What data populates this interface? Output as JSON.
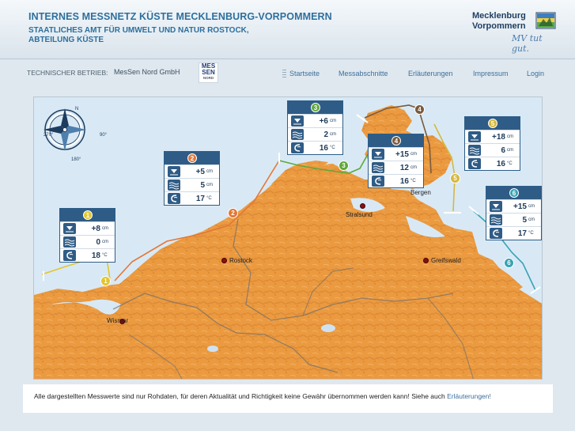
{
  "header": {
    "title": "INTERNES MESSNETZ KÜSTE MECKLENBURG-VORPOMMERN",
    "subtitle_line1": "STAATLICHES AMT FÜR UMWELT UND NATUR ROSTOCK,",
    "subtitle_line2": "ABTEILUNG KÜSTE",
    "logo_line1": "Mecklenburg",
    "logo_line2": "Vorpommern",
    "logo_slogan": "MV tut gut."
  },
  "operator": {
    "label": "TECHNISCHER BETRIEB:",
    "name": "MesSen Nord GmbH",
    "logo_line1": "MES",
    "logo_line2": "SEN",
    "logo_line3": "NORD"
  },
  "nav": {
    "items": [
      "Startseite",
      "Messabschnitte",
      "Erläuterungen",
      "Impressum",
      "Login"
    ]
  },
  "compass": {
    "n": "N",
    "e": "90°",
    "s": "180°",
    "w": "270°"
  },
  "stations": [
    {
      "id": "1",
      "color": "#e3c52e",
      "water_level": "+8",
      "level_unit": "cm",
      "wave": "0",
      "wave_unit": "cm",
      "temp": "18",
      "temp_unit": "°C"
    },
    {
      "id": "2",
      "color": "#e47737",
      "water_level": "+5",
      "level_unit": "cm",
      "wave": "5",
      "wave_unit": "cm",
      "temp": "17",
      "temp_unit": "°C"
    },
    {
      "id": "3",
      "color": "#5fa83a",
      "water_level": "+6",
      "level_unit": "cm",
      "wave": "2",
      "wave_unit": "cm",
      "temp": "16",
      "temp_unit": "°C"
    },
    {
      "id": "4",
      "color": "#7b5a3c",
      "water_level": "+15",
      "level_unit": "cm",
      "wave": "12",
      "wave_unit": "cm",
      "temp": "16",
      "temp_unit": "°C"
    },
    {
      "id": "5",
      "color": "#d5b840",
      "water_level": "+18",
      "level_unit": "cm",
      "wave": "6",
      "wave_unit": "cm",
      "temp": "16",
      "temp_unit": "°C"
    },
    {
      "id": "6",
      "color": "#37a4b3",
      "water_level": "+15",
      "level_unit": "cm",
      "wave": "5",
      "wave_unit": "cm",
      "temp": "17",
      "temp_unit": "°C"
    }
  ],
  "cities": [
    "Wismar",
    "Rostock",
    "Stralsund",
    "Bergen",
    "Greifswald"
  ],
  "footer": {
    "text": "Alle dargestellten Messwerte sind nur Rohdaten, für deren Aktualität und Richtigkeit keine Gewähr übernommen werden kann! Siehe auch ",
    "link": "Erläuterungen!"
  },
  "colors": {
    "accent": "#2e6f9d",
    "panel_header": "#2f5c86",
    "land": "#e9953c",
    "sea": "#d8e9f5"
  }
}
